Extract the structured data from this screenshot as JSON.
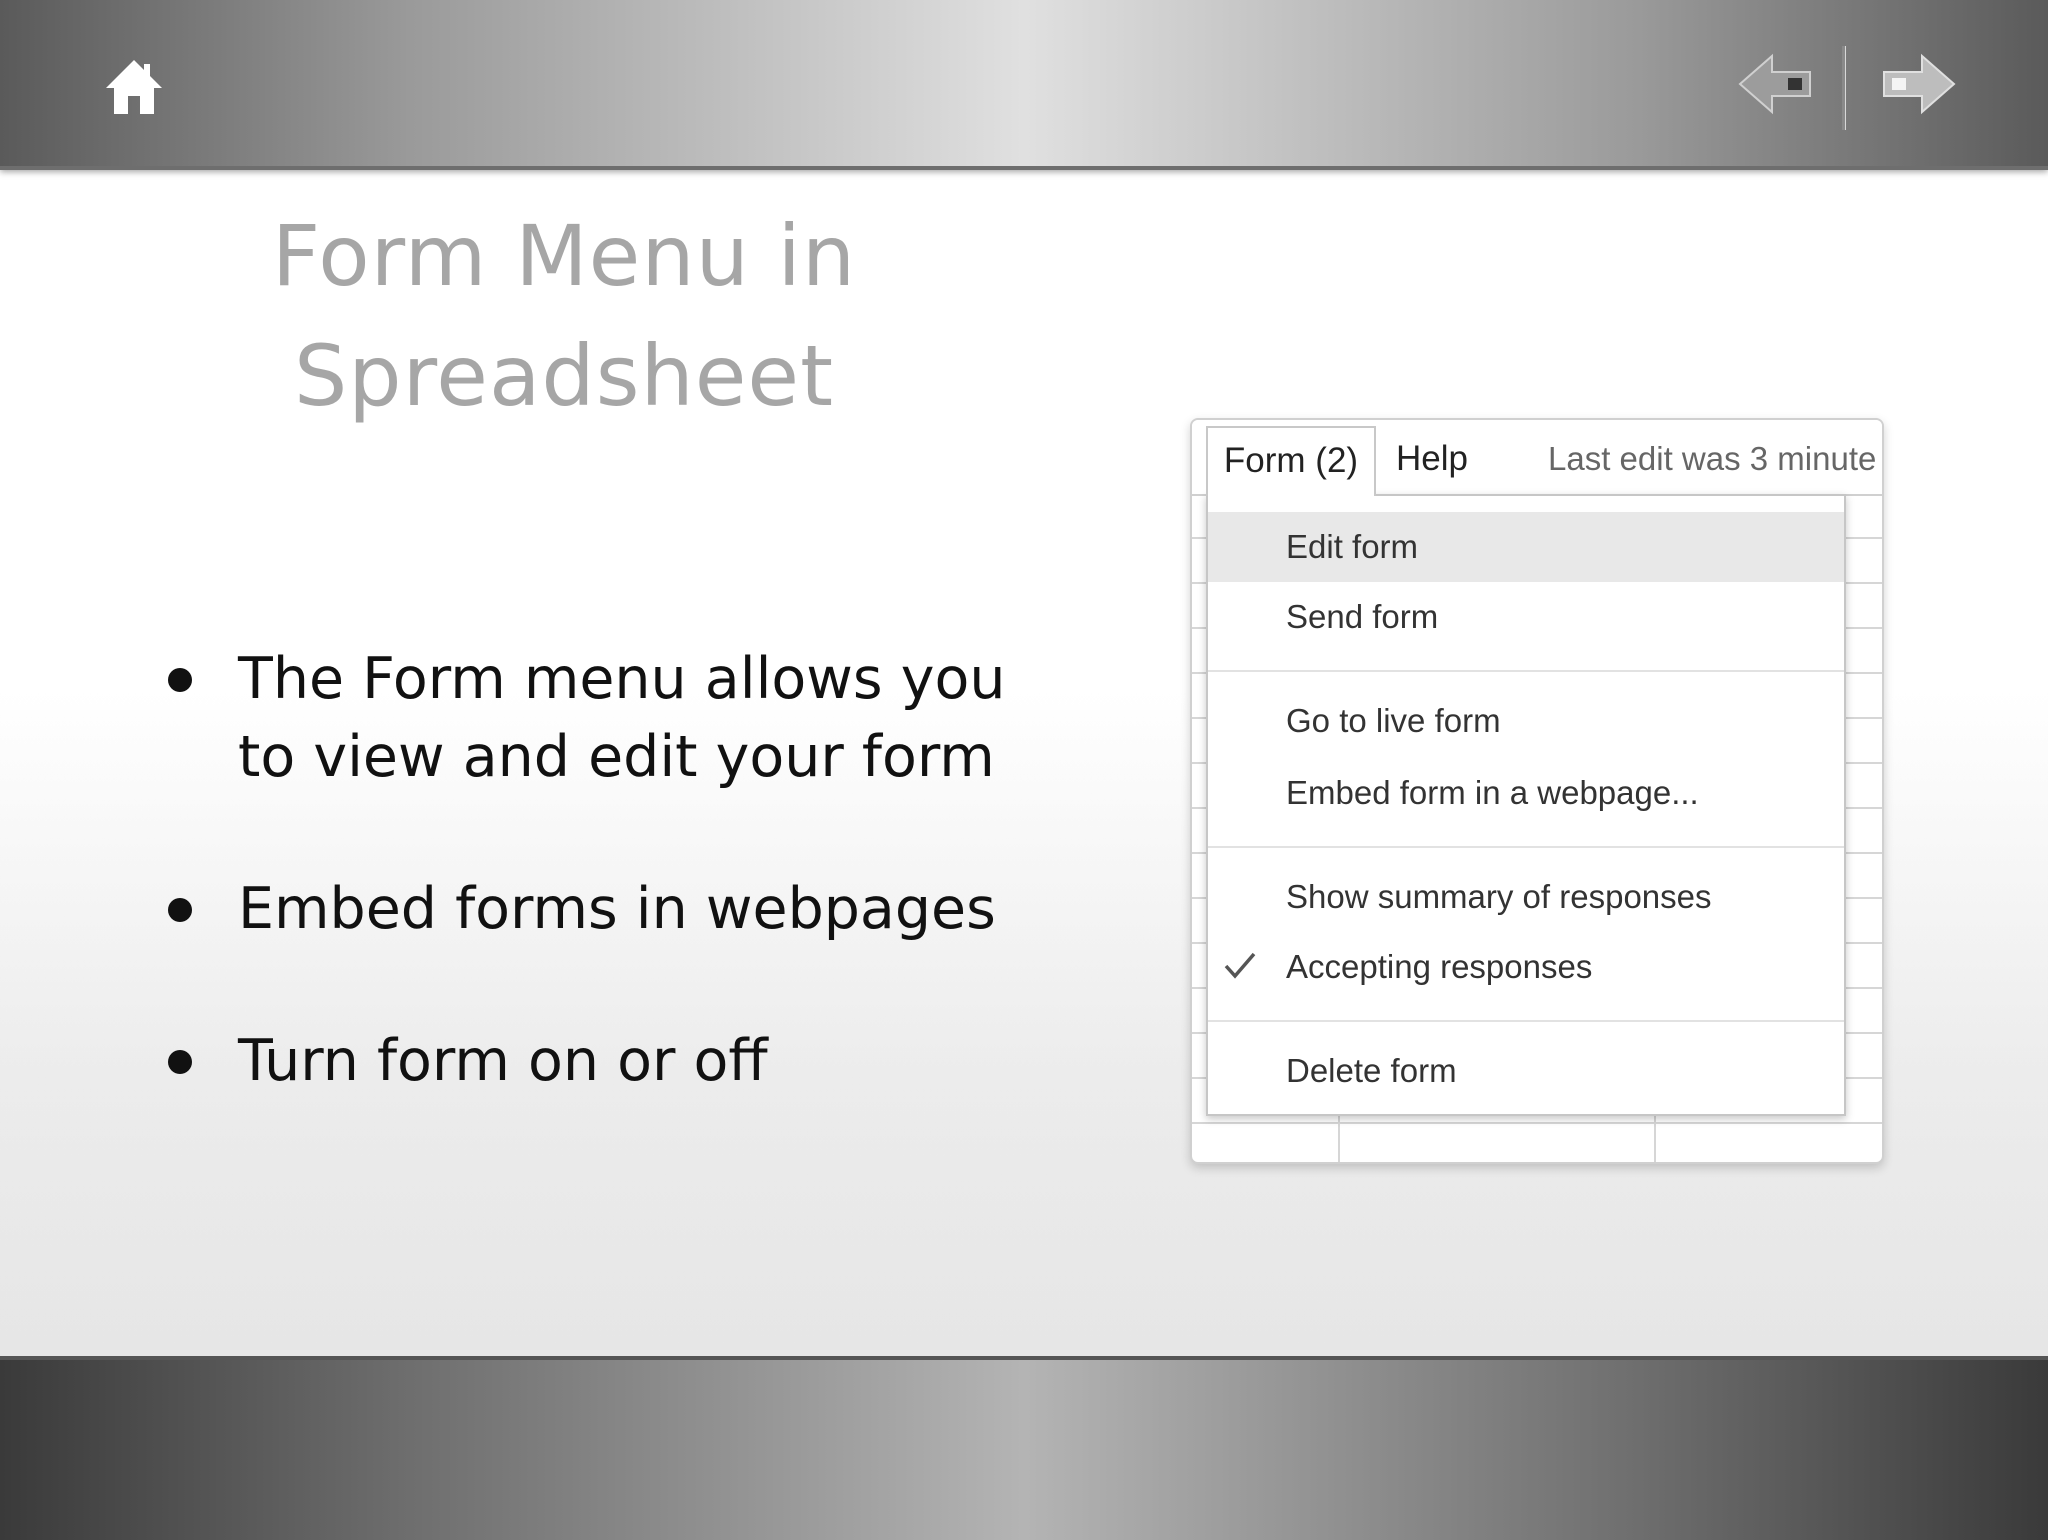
{
  "slide": {
    "title_line1": "Form Menu in",
    "title_line2": "Spreadsheet",
    "bullets": [
      {
        "line1": "The Form menu allows you",
        "line2": "to view and edit your form"
      },
      {
        "line1": "Embed forms in webpages"
      },
      {
        "line1": "Turn form on or off"
      }
    ]
  },
  "navigation": {
    "home_icon": "home-icon",
    "prev_icon": "arrow-left-icon",
    "next_icon": "arrow-right-icon"
  },
  "screenshot": {
    "menubar": {
      "form_label": "Form (2)",
      "help_label": "Help",
      "last_edit": "Last edit was 3 minute"
    },
    "dropdown": {
      "items": [
        {
          "label": "Edit form",
          "highlighted": true
        },
        {
          "label": "Send form"
        },
        {
          "label": "Go to live form"
        },
        {
          "label": "Embed form in a webpage..."
        },
        {
          "label": "Show summary of responses"
        },
        {
          "label": "Accepting responses",
          "checked": true
        },
        {
          "label": "Delete form"
        }
      ]
    }
  },
  "colors": {
    "title": "#a6a6a6",
    "body_text": "#111111",
    "menu_highlight": "#e8e8e8"
  }
}
